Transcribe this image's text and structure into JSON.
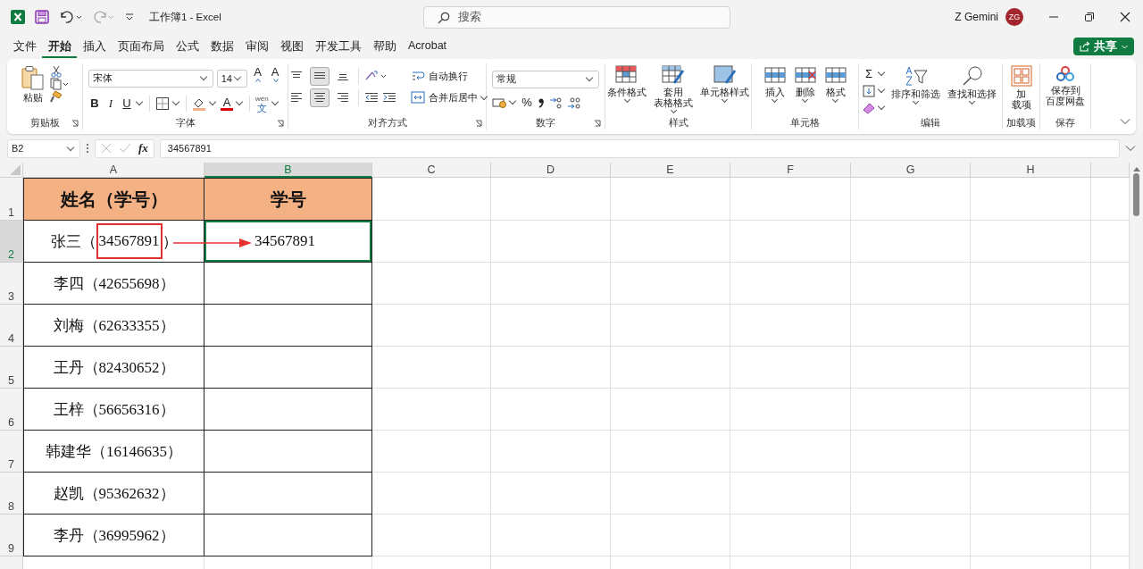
{
  "title_bar": {
    "title": "工作簿1 - Excel",
    "search_placeholder": "搜索",
    "user_name": "Z Gemini",
    "avatar_initials": "ZG"
  },
  "menu_tabs": [
    {
      "label": "文件",
      "selected": false
    },
    {
      "label": "开始",
      "selected": true
    },
    {
      "label": "插入",
      "selected": false
    },
    {
      "label": "页面布局",
      "selected": false
    },
    {
      "label": "公式",
      "selected": false
    },
    {
      "label": "数据",
      "selected": false
    },
    {
      "label": "审阅",
      "selected": false
    },
    {
      "label": "视图",
      "selected": false
    },
    {
      "label": "开发工具",
      "selected": false
    },
    {
      "label": "帮助",
      "selected": false
    },
    {
      "label": "Acrobat",
      "selected": false
    }
  ],
  "share_button": "共享",
  "ribbon": {
    "clipboard": {
      "label": "剪贴板",
      "paste": "粘贴"
    },
    "font": {
      "label": "字体",
      "font_name": "宋体",
      "font_size": "14",
      "grow": "A",
      "shrink": "A",
      "bold": "B",
      "italic": "I",
      "underline": "U",
      "font_color": "A",
      "phonetic_top": "wén",
      "phonetic_bottom": "文"
    },
    "alignment": {
      "label": "对齐方式",
      "wrap_text": "自动换行",
      "merge_center": "合并后居中",
      "top_row": [
        {
          "selected": false
        },
        {
          "selected": true
        },
        {
          "selected": false
        }
      ],
      "bottom_row": [
        {
          "selected": false
        },
        {
          "selected": true
        },
        {
          "selected": false
        }
      ]
    },
    "number": {
      "label": "数字",
      "format": "常规",
      "percent": "%"
    },
    "styles": {
      "label": "样式",
      "buttons": [
        {
          "lines": [
            "条件格式"
          ]
        },
        {
          "lines": [
            "套用",
            "表格格式"
          ]
        },
        {
          "lines": [
            "单元格样式"
          ]
        }
      ]
    },
    "cells": {
      "label": "单元格",
      "buttons": [
        {
          "lines": [
            "插入"
          ]
        },
        {
          "lines": [
            "删除"
          ]
        },
        {
          "lines": [
            "格式"
          ]
        }
      ]
    },
    "editing": {
      "label": "编辑",
      "autosum": "Σ",
      "buttons": [
        {
          "lines": [
            "排序和筛选"
          ]
        },
        {
          "lines": [
            "查找和选择"
          ]
        }
      ]
    },
    "addins": {
      "label": "加载项",
      "lines": [
        "加",
        "载项"
      ]
    },
    "save": {
      "label": "保存",
      "lines": [
        "保存到",
        "百度网盘"
      ]
    }
  },
  "formula_bar": {
    "name_box": "B2",
    "fx": "fx",
    "value": "34567891"
  },
  "sheet": {
    "columns": [
      {
        "label": "A",
        "selected": false
      },
      {
        "label": "B",
        "selected": true
      },
      {
        "label": "C",
        "selected": false
      },
      {
        "label": "D",
        "selected": false
      },
      {
        "label": "E",
        "selected": false
      },
      {
        "label": "F",
        "selected": false
      },
      {
        "label": "G",
        "selected": false
      },
      {
        "label": "H",
        "selected": false
      }
    ],
    "rows": [
      {
        "label": "1",
        "selected": false,
        "cells": [
          {
            "kind": "header",
            "text": "姓名（学号）",
            "active": false
          },
          {
            "kind": "header",
            "text": "学号",
            "active": false
          }
        ]
      },
      {
        "label": "2",
        "selected": true,
        "cells": [
          {
            "kind": "segmented",
            "active": false,
            "segments": [
              {
                "text": "张三（",
                "boxed": false
              },
              {
                "text": "34567891",
                "boxed": true
              },
              {
                "text": "）",
                "boxed": false
              }
            ]
          },
          {
            "kind": "data",
            "text": "34567891",
            "active": true
          }
        ]
      },
      {
        "label": "3",
        "selected": false,
        "cells": [
          {
            "kind": "data",
            "text": "李四（42655698）",
            "active": false
          },
          {
            "kind": "data",
            "active": false
          }
        ]
      },
      {
        "label": "4",
        "selected": false,
        "cells": [
          {
            "kind": "data",
            "text": "刘梅（62633355）",
            "active": false
          },
          {
            "kind": "data",
            "active": false
          }
        ]
      },
      {
        "label": "5",
        "selected": false,
        "cells": [
          {
            "kind": "data",
            "text": "王丹（82430652）",
            "active": false
          },
          {
            "kind": "data",
            "active": false
          }
        ]
      },
      {
        "label": "6",
        "selected": false,
        "cells": [
          {
            "kind": "data",
            "text": "王梓（56656316）",
            "active": false
          },
          {
            "kind": "data",
            "active": false
          }
        ]
      },
      {
        "label": "7",
        "selected": false,
        "cells": [
          {
            "kind": "data",
            "text": "韩建华（16146635）",
            "active": false
          },
          {
            "kind": "data",
            "active": false
          }
        ]
      },
      {
        "label": "8",
        "selected": false,
        "cells": [
          {
            "kind": "data",
            "text": "赵凯（95362632）",
            "active": false
          },
          {
            "kind": "data",
            "active": false
          }
        ]
      },
      {
        "label": "9",
        "selected": false,
        "cells": [
          {
            "kind": "data",
            "text": "李丹（36995962）",
            "active": false
          },
          {
            "kind": "data",
            "active": false
          }
        ]
      }
    ]
  }
}
